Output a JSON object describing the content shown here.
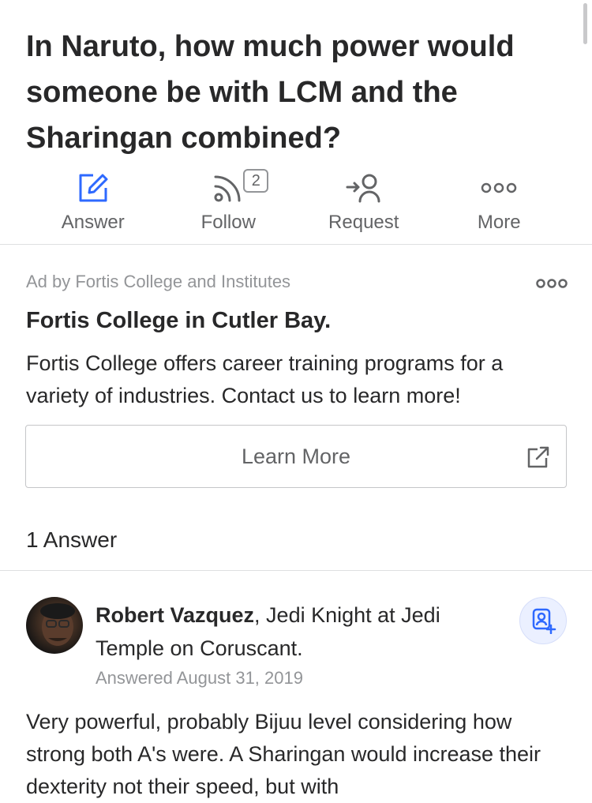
{
  "question": {
    "title": "In Naruto, how much power would someone be with LCM and the Sharingan combined?"
  },
  "actions": [
    {
      "label": "Answer",
      "icon": "pencil-square-icon",
      "color": "#2e69ff"
    },
    {
      "label": "Follow",
      "icon": "rss-follow-icon",
      "badge": "2"
    },
    {
      "label": "Request",
      "icon": "request-person-icon"
    },
    {
      "label": "More",
      "icon": "more-dots-icon"
    }
  ],
  "ad": {
    "by": "Ad by Fortis College and Institutes",
    "title": "Fortis College in Cutler Bay.",
    "body": "Fortis College offers career training programs for a variety of industries. Contact us to learn more!",
    "button_label": "Learn More",
    "button_icon": "external-link-icon"
  },
  "answers": {
    "count_label": "1 Answer",
    "items": [
      {
        "author": "Robert Vazquez",
        "credential": ", Jedi Knight at Jedi Temple on Coruscant.",
        "date": "Answered August 31, 2019",
        "text": "Very powerful, probably Bijuu level considering how strong both A's were. A Sharingan would increase their dexterity not their speed, but with"
      }
    ]
  },
  "colors": {
    "accent": "#2e69ff",
    "text": "#282829",
    "muted": "#636466",
    "faint": "#939598",
    "divider": "#dee0e1",
    "follow_button_bg": "#ebf0ff"
  }
}
